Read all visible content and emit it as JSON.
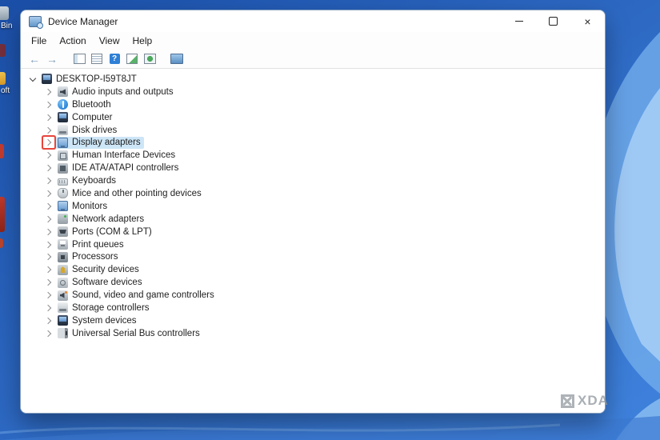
{
  "desktop": {
    "icon_fragments": [
      {
        "label": "Bin"
      },
      {
        "label": "oft"
      }
    ],
    "watermark": {
      "text": "XDA"
    },
    "wallpaper_colors": {
      "base": "#2a60b8",
      "swoosh": "#6fa9ea",
      "highlight": "#a5cdf6"
    }
  },
  "annotation": {
    "highlight_box_color": "#e8453c"
  },
  "window": {
    "title": "Device Manager",
    "controls": {
      "close": "×"
    },
    "menu": [
      {
        "label": "File"
      },
      {
        "label": "Action"
      },
      {
        "label": "View"
      },
      {
        "label": "Help"
      }
    ],
    "toolbar": {
      "icons": [
        "back",
        "forward",
        "console-tree",
        "properties",
        "help",
        "export-list",
        "scan-hardware",
        "devices"
      ]
    }
  },
  "tree": {
    "root": {
      "label": "DESKTOP-I59T8JT",
      "expanded": true
    },
    "items": [
      {
        "label": "Audio inputs and outputs",
        "icon": "audio"
      },
      {
        "label": "Bluetooth",
        "icon": "bluetooth"
      },
      {
        "label": "Computer",
        "icon": "computer"
      },
      {
        "label": "Disk drives",
        "icon": "disk"
      },
      {
        "label": "Display adapters",
        "icon": "display",
        "selected": true,
        "annotated": true
      },
      {
        "label": "Human Interface Devices",
        "icon": "hid"
      },
      {
        "label": "IDE ATA/ATAPI controllers",
        "icon": "ide"
      },
      {
        "label": "Keyboards",
        "icon": "keyboard"
      },
      {
        "label": "Mice and other pointing devices",
        "icon": "mouse"
      },
      {
        "label": "Monitors",
        "icon": "monitor"
      },
      {
        "label": "Network adapters",
        "icon": "network"
      },
      {
        "label": "Ports (COM & LPT)",
        "icon": "ports"
      },
      {
        "label": "Print queues",
        "icon": "printer"
      },
      {
        "label": "Processors",
        "icon": "processor"
      },
      {
        "label": "Security devices",
        "icon": "security"
      },
      {
        "label": "Software devices",
        "icon": "software"
      },
      {
        "label": "Sound, video and game controllers",
        "icon": "sound"
      },
      {
        "label": "Storage controllers",
        "icon": "storage"
      },
      {
        "label": "System devices",
        "icon": "system"
      },
      {
        "label": "Universal Serial Bus controllers",
        "icon": "usb"
      }
    ]
  }
}
